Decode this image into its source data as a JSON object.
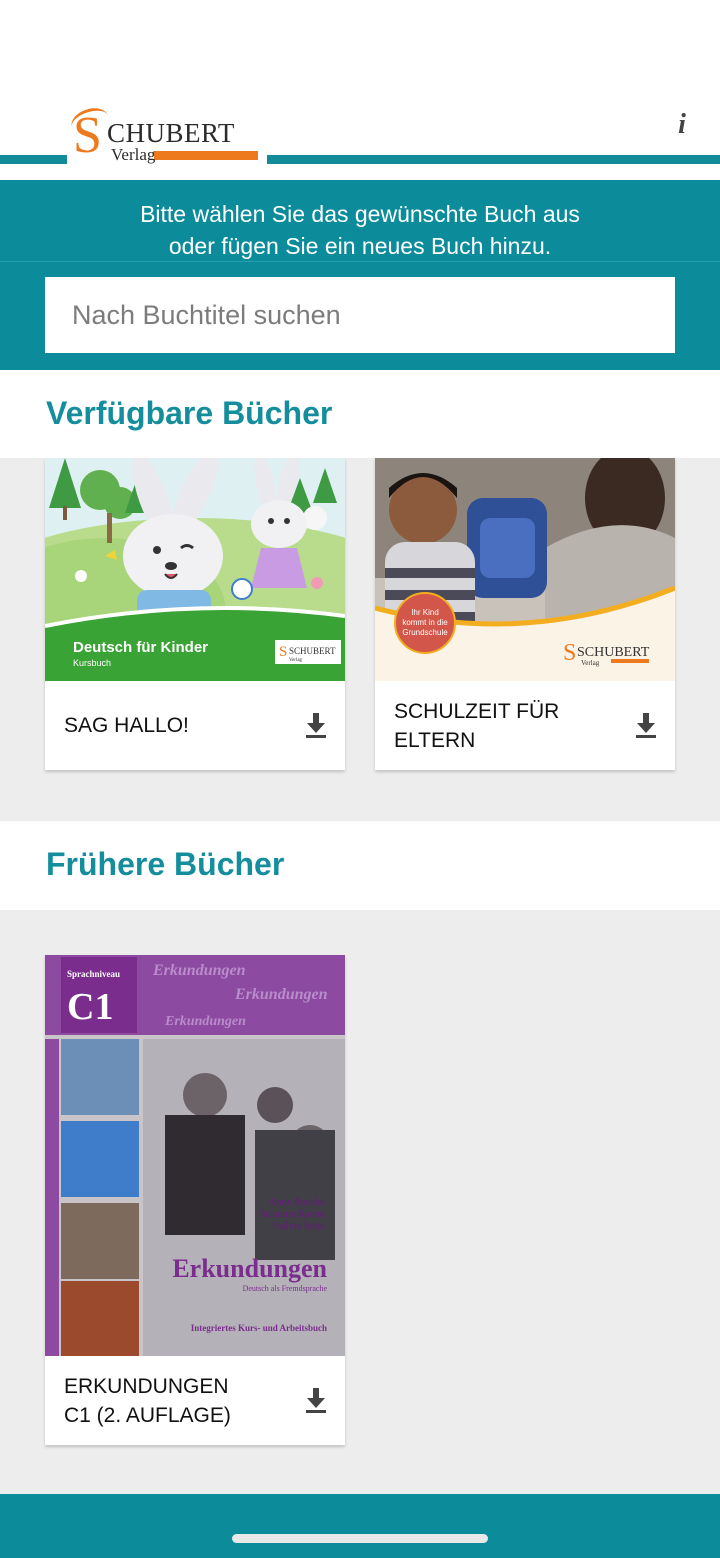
{
  "header": {
    "logo": {
      "brand": "SCHUBERT",
      "initial": "S",
      "name_rest": "CHUBERT",
      "subtitle": "Verlag"
    },
    "info_icon": "info-icon"
  },
  "intro": {
    "line1": "Bitte wählen Sie das gewünschte Buch aus",
    "line2": "oder fügen Sie ein neues Buch hinzu."
  },
  "search": {
    "placeholder": "Nach Buchtitel suchen",
    "value": ""
  },
  "sections": {
    "available": {
      "title": "Verfügbare Bücher",
      "books": [
        {
          "title": "SAG HALLO!",
          "cover": {
            "title": "Deutsch für Kinder",
            "subtitle": "Kursbuch",
            "publisher": "SCHUBERT",
            "publisher_sub": "Verlag"
          }
        },
        {
          "title_line1": "SCHULZEIT FÜR",
          "title_line2": "ELTERN",
          "cover": {
            "badge_line1": "Ihr Kind",
            "badge_line2": "kommt in die",
            "badge_line3": "Grundschule",
            "publisher": "SCHUBERT",
            "publisher_sub": "Verlag"
          }
        }
      ]
    },
    "earlier": {
      "title": "Frühere Bücher",
      "books": [
        {
          "title_line1": "ERKUNDUNGEN",
          "title_line2": "C1 (2. AUFLAGE)",
          "cover": {
            "level_label": "Sprachniveau",
            "level": "C1",
            "bg_word": "Erkundungen",
            "authors": [
              "Anne Buscha",
              "Susanne Raven",
              "Szilvia Szita"
            ],
            "title": "Erkundungen",
            "subtitle": "Deutsch als Fremdsprache",
            "footer": "Integriertes Kurs- und Arbeitsbuch"
          }
        }
      ]
    }
  },
  "colors": {
    "teal": "#0c8c9b",
    "accent_text": "#148e9c",
    "orange": "#ee7a1e",
    "purple": "#7b2d8e",
    "green": "#3aa335"
  },
  "icons": {
    "download": "download-icon"
  }
}
